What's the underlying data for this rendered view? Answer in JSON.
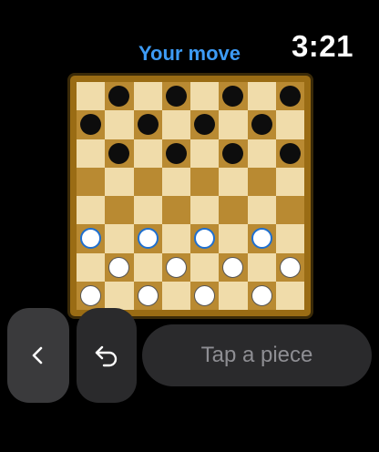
{
  "header": {
    "status": "Your move",
    "time": "3:21"
  },
  "board": {
    "rows": [
      [
        "",
        "b",
        "",
        "b",
        "",
        "b",
        "",
        "b"
      ],
      [
        "b",
        "",
        "b",
        "",
        "b",
        "",
        "b",
        ""
      ],
      [
        "",
        "b",
        "",
        "b",
        "",
        "b",
        "",
        "b"
      ],
      [
        "",
        "",
        "",
        "",
        "",
        "",
        "",
        ""
      ],
      [
        "",
        "",
        "",
        "",
        "",
        "",
        "",
        ""
      ],
      [
        "w*",
        "",
        "w*",
        "",
        "w*",
        "",
        "w*",
        ""
      ],
      [
        "",
        "w",
        "",
        "w",
        "",
        "w",
        "",
        "w"
      ],
      [
        "w",
        "",
        "w",
        "",
        "w",
        "",
        "w",
        ""
      ]
    ],
    "colors": {
      "light": "#f0dcaa",
      "dark": "#b98a32",
      "frame": "#9a6c14",
      "highlight": "#1e6fd0"
    }
  },
  "controls": {
    "back_icon": "chevron-left-icon",
    "undo_icon": "undo-arrow-icon",
    "hint_label": "Tap a piece"
  }
}
